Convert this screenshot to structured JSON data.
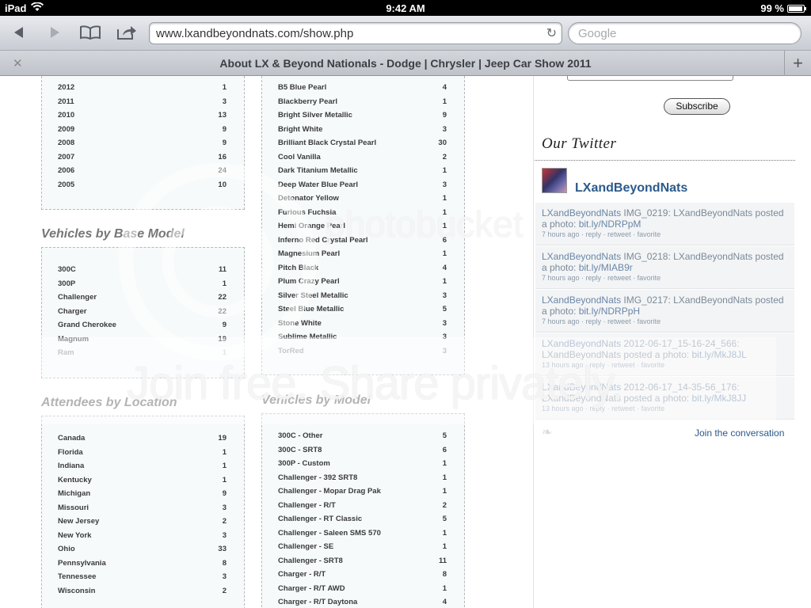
{
  "status_bar": {
    "device": "iPad",
    "time": "9:42 AM",
    "battery": "99 %"
  },
  "toolbar": {
    "url": "www.lxandbeyondnats.com/show.php",
    "search_placeholder": "Google"
  },
  "tab": {
    "title": "About LX & Beyond Nationals - Dodge | Chrysler | Jeep Car Show 2011"
  },
  "years": [
    {
      "label": "2012",
      "count": "1"
    },
    {
      "label": "2011",
      "count": "3"
    },
    {
      "label": "2010",
      "count": "13"
    },
    {
      "label": "2009",
      "count": "9"
    },
    {
      "label": "2008",
      "count": "9"
    },
    {
      "label": "2007",
      "count": "16"
    },
    {
      "label": "2006",
      "count": "24"
    },
    {
      "label": "2005",
      "count": "10"
    }
  ],
  "base_model": {
    "title": "Vehicles by Base Model",
    "rows": [
      {
        "label": "300C",
        "count": "11"
      },
      {
        "label": "300P",
        "count": "1"
      },
      {
        "label": "Challenger",
        "count": "22"
      },
      {
        "label": "Charger",
        "count": "22"
      },
      {
        "label": "Grand Cherokee",
        "count": "9"
      },
      {
        "label": "Magnum",
        "count": "19"
      },
      {
        "label": "Ram",
        "count": "1"
      }
    ]
  },
  "colors": [
    {
      "label": "B5 Blue Pearl",
      "count": "4"
    },
    {
      "label": "Blackberry Pearl",
      "count": "1"
    },
    {
      "label": "Bright Silver Metallic",
      "count": "9"
    },
    {
      "label": "Bright White",
      "count": "3"
    },
    {
      "label": "Brilliant Black Crystal Pearl",
      "count": "30"
    },
    {
      "label": "Cool Vanilla",
      "count": "2"
    },
    {
      "label": "Dark Titanium Metallic",
      "count": "1"
    },
    {
      "label": "Deep Water Blue Pearl",
      "count": "3"
    },
    {
      "label": "Detonator Yellow",
      "count": "1"
    },
    {
      "label": "Furious Fuchsia",
      "count": "1"
    },
    {
      "label": "Hemi Orange Pearl",
      "count": "1"
    },
    {
      "label": "Inferno Red Crystal Pearl",
      "count": "6"
    },
    {
      "label": "Magnesium Pearl",
      "count": "1"
    },
    {
      "label": "Pitch Black",
      "count": "4"
    },
    {
      "label": "Plum Crazy Pearl",
      "count": "1"
    },
    {
      "label": "Silver Steel Metallic",
      "count": "3"
    },
    {
      "label": "Steel Blue Metallic",
      "count": "5"
    },
    {
      "label": "Stone White",
      "count": "3"
    },
    {
      "label": "Sublime Metallic",
      "count": "3"
    },
    {
      "label": "TorRed",
      "count": "3"
    }
  ],
  "location": {
    "title": "Attendees by Location",
    "rows": [
      {
        "label": "Canada",
        "count": "19"
      },
      {
        "label": "Florida",
        "count": "1"
      },
      {
        "label": "Indiana",
        "count": "1"
      },
      {
        "label": "Kentucky",
        "count": "1"
      },
      {
        "label": "Michigan",
        "count": "9"
      },
      {
        "label": "Missouri",
        "count": "3"
      },
      {
        "label": "New Jersey",
        "count": "2"
      },
      {
        "label": "New York",
        "count": "3"
      },
      {
        "label": "Ohio",
        "count": "33"
      },
      {
        "label": "Pennsylvania",
        "count": "8"
      },
      {
        "label": "Tennessee",
        "count": "3"
      },
      {
        "label": "Wisconsin",
        "count": "2"
      }
    ]
  },
  "model": {
    "title": "Vehicles by Model",
    "rows": [
      {
        "label": "300C - Other",
        "count": "5"
      },
      {
        "label": "300C - SRT8",
        "count": "6"
      },
      {
        "label": "300P - Custom",
        "count": "1"
      },
      {
        "label": "Challenger - 392 SRT8",
        "count": "1"
      },
      {
        "label": "Challenger - Mopar Drag Pak",
        "count": "1"
      },
      {
        "label": "Challenger - R/T",
        "count": "2"
      },
      {
        "label": "Challenger - RT Classic",
        "count": "5"
      },
      {
        "label": "Challenger - Saleen SMS 570",
        "count": "1"
      },
      {
        "label": "Challenger - SE",
        "count": "1"
      },
      {
        "label": "Challenger - SRT8",
        "count": "11"
      },
      {
        "label": "Charger - R/T",
        "count": "8"
      },
      {
        "label": "Charger - R/T AWD",
        "count": "1"
      },
      {
        "label": "Charger - R/T Daytona",
        "count": "4"
      }
    ]
  },
  "sidebar": {
    "subscribe_label": "Subscribe",
    "twitter_title": "Our Twitter",
    "twitter_user": "LXandBeyondNats",
    "join_label": "Join the conversation",
    "tweets": [
      {
        "user": "LXandBeyondNats",
        "text": " IMG_0219: LXandBeyondNats posted a photo: ",
        "link": "bit.ly/NDRPpM",
        "time": "7 hours ago",
        "reply": "reply",
        "retweet": "retweet",
        "favorite": "favorite"
      },
      {
        "user": "LXandBeyondNats",
        "text": " IMG_0218: LXandBeyondNats posted a photo: ",
        "link": "bit.ly/MIAB9r",
        "time": "7 hours ago",
        "reply": "reply",
        "retweet": "retweet",
        "favorite": "favorite"
      },
      {
        "user": "LXandBeyondNats",
        "text": " IMG_0217: LXandBeyondNats posted a photo: ",
        "link": "bit.ly/NDRPpH",
        "time": "7 hours ago",
        "reply": "reply",
        "retweet": "retweet",
        "favorite": "favorite"
      },
      {
        "user": "LXandBeyondNats",
        "text": " 2012-06-17_15-16-24_566: LXandBeyondNats posted a photo: ",
        "link": "bit.ly/MkJ8JL",
        "time": "13 hours ago",
        "reply": "reply",
        "retweet": "retweet",
        "favorite": "favorite"
      },
      {
        "user": "LXandBeyondNats",
        "text": " 2012-06-17_14-35-56_176: LXandBeyondNats posted a photo: ",
        "link": "bit.ly/MkJ8JJ",
        "time": "13 hours ago",
        "reply": "reply",
        "retweet": "retweet",
        "favorite": "favorite"
      }
    ]
  },
  "watermark": {
    "top": "photobucket",
    "bottom": "Join free. Share privately."
  }
}
